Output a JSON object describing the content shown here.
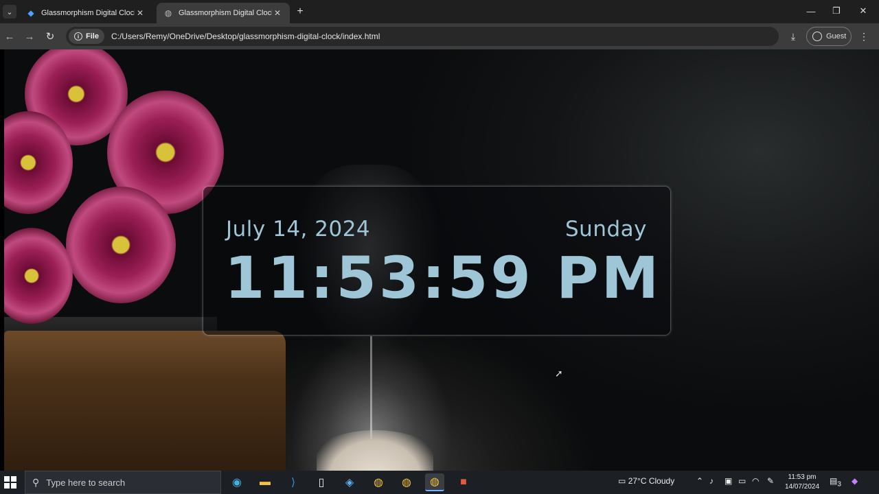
{
  "browser": {
    "tabs": [
      {
        "title": "Glassmorphism Digital Clock U",
        "favicon": "flame-icon"
      },
      {
        "title": "Glassmorphism Digital Clock",
        "favicon": "globe-icon"
      }
    ],
    "file_chip": "File",
    "url": "C:/Users/Remy/OneDrive/Desktop/glassmorphism-digital-clock/index.html",
    "profile": "Guest"
  },
  "clock": {
    "date": "July 14, 2024",
    "day": "Sunday",
    "time": "11:53:59 PM",
    "color": "#9ec6d6"
  },
  "taskbar": {
    "search_placeholder": "Type here to search",
    "weather": "27°C  Cloudy",
    "time": "11:53 pm",
    "date": "14/07/2024",
    "notifications": "3"
  }
}
